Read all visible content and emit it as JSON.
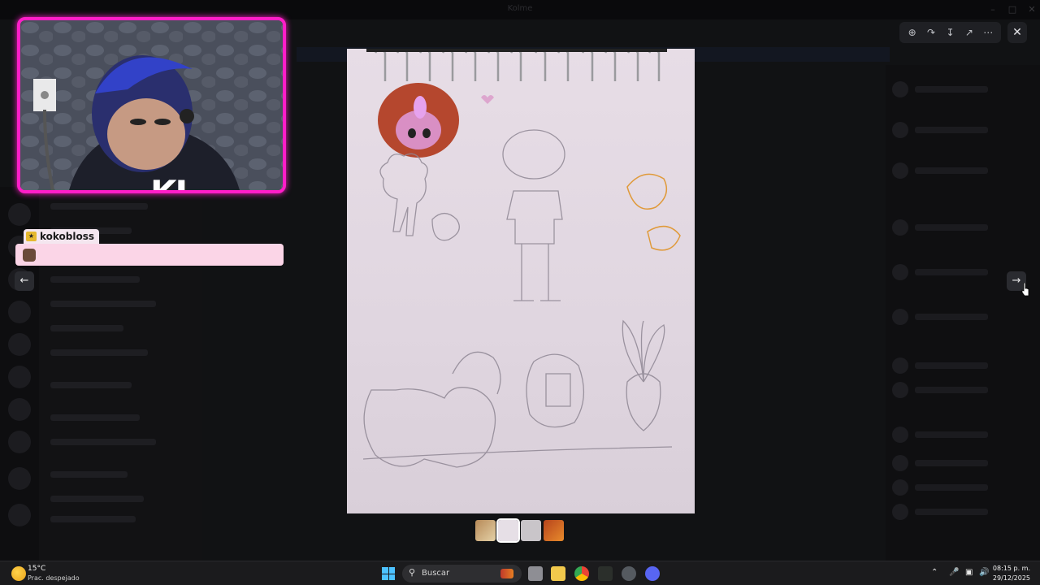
{
  "app": {
    "window_title": "Kolme"
  },
  "viewer": {
    "toolbar_icons": [
      "zoom-in-icon",
      "rotate-icon",
      "download-icon",
      "open-external-icon",
      "more-icon"
    ],
    "close_icon": "close-icon",
    "prev_icon": "arrow-left-icon",
    "next_icon": "arrow-right-icon",
    "thumbnails_count": 4
  },
  "stream_overlay": {
    "webcam_label": "KJ",
    "chat": {
      "username": "kokobloss",
      "message": ""
    }
  },
  "taskbar": {
    "weather": {
      "temp": "15°C",
      "desc": "Prac. despejado"
    },
    "search_placeholder": "Buscar",
    "time": "08:15 p. m.",
    "date": "29/12/2025"
  },
  "colors": {
    "overlay_accent": "#ff1ec8",
    "chat_bubble": "#fbd5e7",
    "taskbar": "#1b1b1d"
  }
}
